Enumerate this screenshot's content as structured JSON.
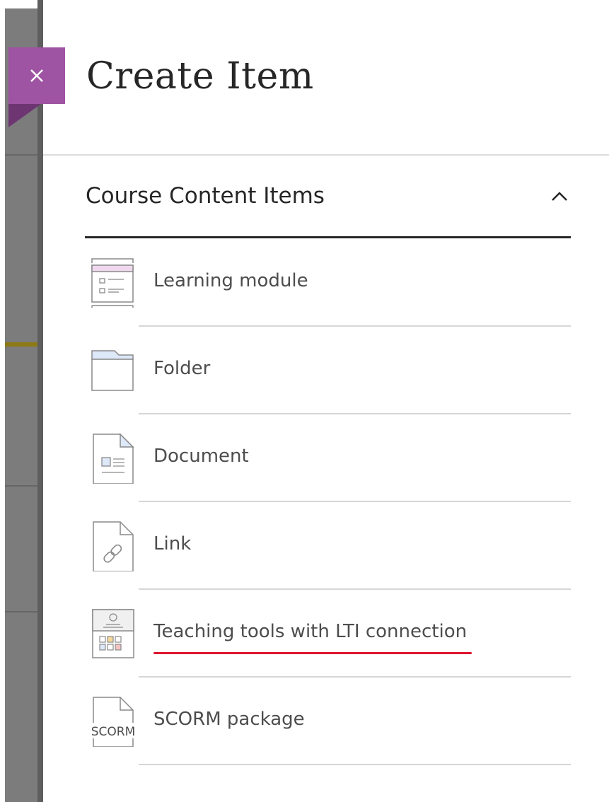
{
  "panel": {
    "title": "Create Item",
    "close_icon": "close-icon"
  },
  "section": {
    "title": "Course Content Items",
    "toggle_icon": "chevron-up-icon",
    "expanded": true
  },
  "items": [
    {
      "label": "Learning module",
      "icon": "learning-module-icon"
    },
    {
      "label": "Folder",
      "icon": "folder-icon"
    },
    {
      "label": "Document",
      "icon": "document-icon"
    },
    {
      "label": "Link",
      "icon": "link-icon"
    },
    {
      "label": "Teaching tools with LTI connection",
      "icon": "lti-tool-icon",
      "underlined": true
    },
    {
      "label": "SCORM package",
      "icon": "scorm-icon",
      "icon_text": "SCORM"
    }
  ],
  "colors": {
    "accent": "#9e53a3",
    "annotation_underline": "#e0142f"
  }
}
